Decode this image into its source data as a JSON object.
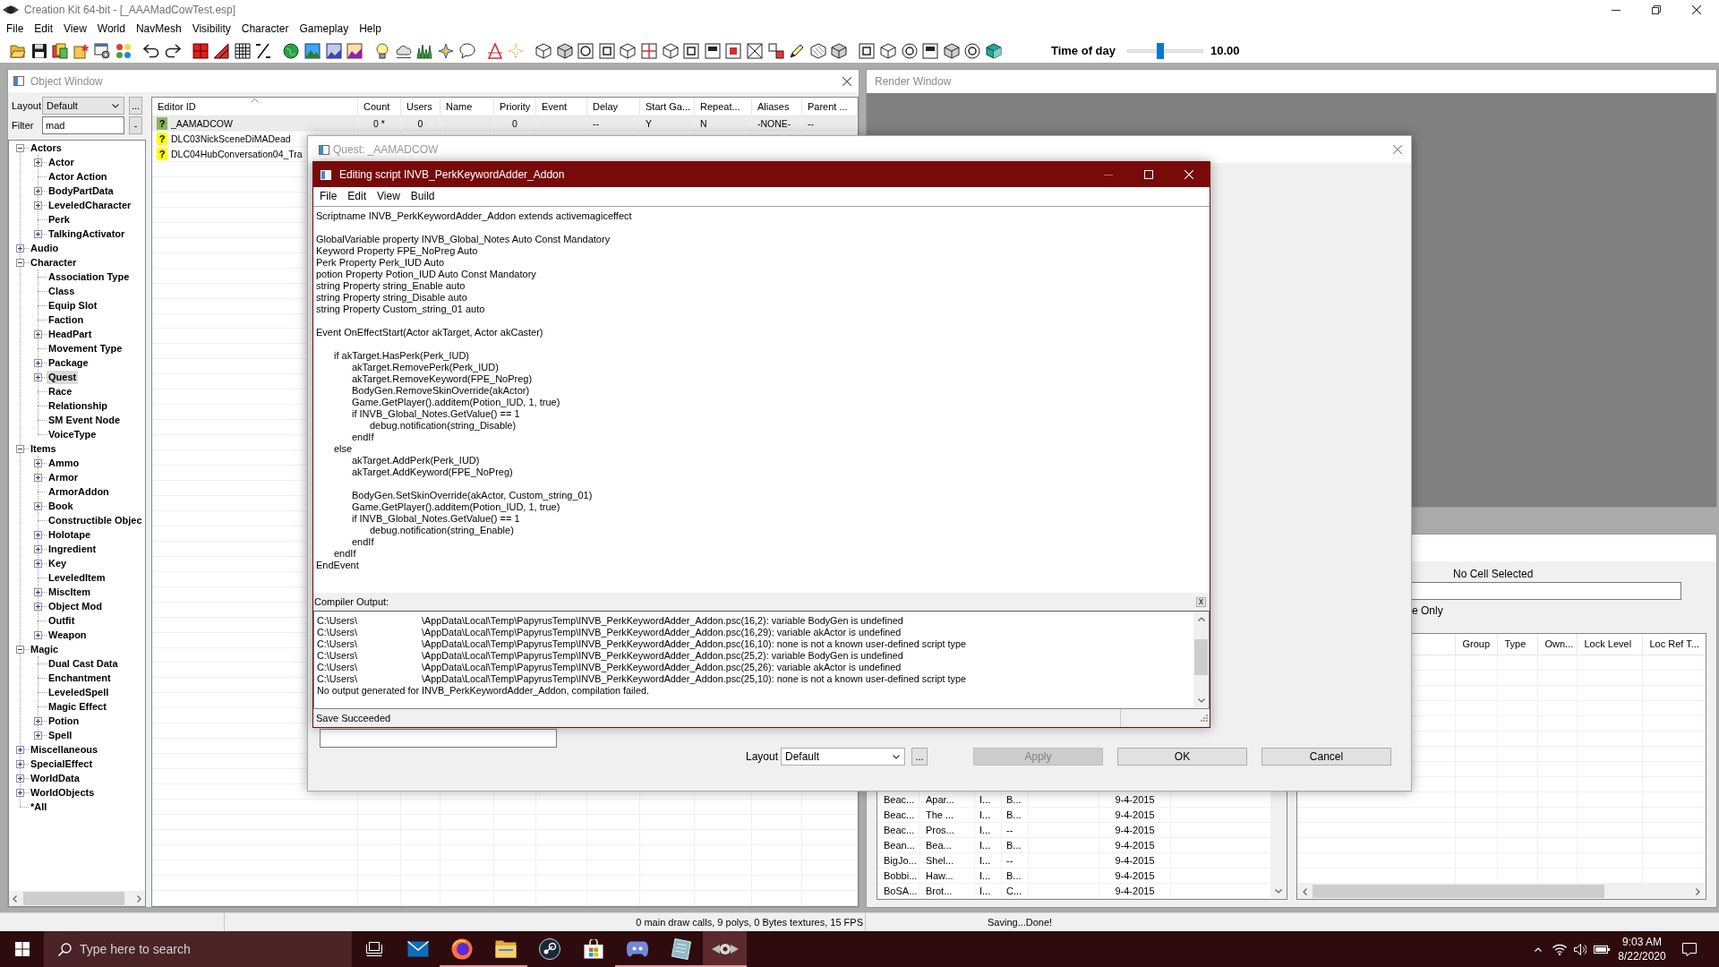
{
  "window": {
    "title": "Creation Kit 64-bit - [_AAAMadCowTest.esp]"
  },
  "menu": [
    "File",
    "Edit",
    "View",
    "World",
    "NavMesh",
    "Visibility",
    "Character",
    "Gameplay",
    "Help"
  ],
  "toolbar": {
    "time_of_day": {
      "label": "Time of day",
      "level": 0.42,
      "reading": "10.00"
    }
  },
  "object_window": {
    "title": "Object Window",
    "layout": {
      "label": "Layout",
      "value": "Default",
      "button": "..."
    },
    "filter": {
      "label": "Filter",
      "value": "mad",
      "button": "-"
    },
    "tree": [
      {
        "label": "Actors",
        "expanded": true,
        "selected": false,
        "children": [
          {
            "label": "Actor",
            "expanded": false,
            "selected": false
          },
          {
            "label": "Actor Action",
            "selected": false
          },
          {
            "label": "BodyPartData",
            "expanded": false,
            "selected": false
          },
          {
            "label": "LeveledCharacter",
            "expanded": false,
            "selected": false
          },
          {
            "label": "Perk",
            "selected": false
          },
          {
            "label": "TalkingActivator",
            "expanded": false,
            "selected": false
          }
        ]
      },
      {
        "label": "Audio",
        "expanded": false,
        "selected": false
      },
      {
        "label": "Character",
        "expanded": true,
        "selected": false,
        "children": [
          {
            "label": "Association Type",
            "selected": false
          },
          {
            "label": "Class",
            "selected": false
          },
          {
            "label": "Equip Slot",
            "selected": false
          },
          {
            "label": "Faction",
            "selected": false
          },
          {
            "label": "HeadPart",
            "expanded": false,
            "selected": false
          },
          {
            "label": "Movement Type",
            "selected": false
          },
          {
            "label": "Package",
            "expanded": false,
            "selected": false
          },
          {
            "label": "Quest",
            "expanded": false,
            "selected": true
          },
          {
            "label": "Race",
            "selected": false
          },
          {
            "label": "Relationship",
            "selected": false
          },
          {
            "label": "SM Event Node",
            "selected": false
          },
          {
            "label": "VoiceType",
            "selected": false
          }
        ]
      },
      {
        "label": "Items",
        "expanded": true,
        "selected": false,
        "children": [
          {
            "label": "Ammo",
            "expanded": false,
            "selected": false
          },
          {
            "label": "Armor",
            "expanded": false,
            "selected": false
          },
          {
            "label": "ArmorAddon",
            "selected": false
          },
          {
            "label": "Book",
            "expanded": false,
            "selected": false
          },
          {
            "label": "Constructible Objec",
            "selected": false
          },
          {
            "label": "Holotape",
            "expanded": false,
            "selected": false
          },
          {
            "label": "Ingredient",
            "expanded": false,
            "selected": false
          },
          {
            "label": "Key",
            "expanded": false,
            "selected": false
          },
          {
            "label": "LeveledItem",
            "selected": false
          },
          {
            "label": "MiscItem",
            "expanded": false,
            "selected": false
          },
          {
            "label": "Object Mod",
            "expanded": false,
            "selected": false
          },
          {
            "label": "Outfit",
            "selected": false
          },
          {
            "label": "Weapon",
            "expanded": false,
            "selected": false
          }
        ]
      },
      {
        "label": "Magic",
        "expanded": true,
        "selected": false,
        "children": [
          {
            "label": "Dual Cast Data",
            "selected": false
          },
          {
            "label": "Enchantment",
            "selected": false
          },
          {
            "label": "LeveledSpell",
            "selected": false
          },
          {
            "label": "Magic Effect",
            "selected": false
          },
          {
            "label": "Potion",
            "expanded": false,
            "selected": false
          },
          {
            "label": "Spell",
            "expanded": false,
            "selected": false
          }
        ]
      },
      {
        "label": "Miscellaneous",
        "expanded": false,
        "selected": false
      },
      {
        "label": "SpecialEffect",
        "expanded": false,
        "selected": false
      },
      {
        "label": "WorldData",
        "expanded": false,
        "selected": false
      },
      {
        "label": "WorldObjects",
        "expanded": false,
        "selected": false
      },
      {
        "label": "*All",
        "selected": false
      }
    ],
    "table": {
      "columns": [
        "Editor ID",
        "Count",
        "Users",
        "Name",
        "Priority",
        "Event",
        "Delay",
        "Start Ga...",
        "Repeat...",
        "Aliases",
        "Parent ..."
      ],
      "rows": [
        {
          "mark": "?",
          "color": "#8bb35a",
          "selected": true,
          "cells": [
            "_AAMADCOW",
            "0 *",
            "0",
            null,
            "0",
            null,
            "--",
            "Y",
            "N",
            "-NONE-",
            "--"
          ]
        },
        {
          "mark": "?",
          "color": "#ffff00",
          "selected": false,
          "cells": [
            "DLC03NickSceneDiMADead"
          ]
        },
        {
          "mark": "?",
          "color": "#ffff00",
          "selected": false,
          "cells": [
            "DLC04HubConversation04_Tra"
          ]
        }
      ]
    }
  },
  "render_window": {
    "title": "Render Window"
  },
  "cell_view": {
    "heading": "No Cell Selected",
    "option": "e Only",
    "cell_list": {
      "rows": [
        [
          "Beac...",
          "Apar...",
          "I...",
          "B...",
          null,
          "9-4-2015"
        ],
        [
          "Beac...",
          "The ...",
          "I...",
          "B...",
          null,
          "9-4-2015"
        ],
        [
          "Beac...",
          "Pros...",
          "I...",
          "--",
          null,
          "9-4-2015"
        ],
        [
          "Bean...",
          "Bea...",
          "I...",
          "B...",
          null,
          "9-4-2015"
        ],
        [
          "BigJo...",
          "Shel...",
          "I...",
          "--",
          null,
          "9-4-2015"
        ],
        [
          "Bobbi...",
          "Haw...",
          "I...",
          "B...",
          null,
          "9-4-2015"
        ],
        [
          "BoSA...",
          "Brot...",
          "I...",
          "C...",
          null,
          "9-4-2015"
        ]
      ]
    },
    "object_list": {
      "columns": [
        "Group",
        "Type",
        "Own...",
        "Lock Level",
        "Loc Ref T..."
      ]
    }
  },
  "quest_dialog": {
    "title": "Quest: _AAMADCOW",
    "layout": {
      "label": "Layout",
      "value": "Default",
      "button": "..."
    },
    "buttons": [
      {
        "label": "Apply",
        "disabled": true
      },
      {
        "label": "OK",
        "disabled": false
      },
      {
        "label": "Cancel",
        "disabled": false
      }
    ]
  },
  "script_editor": {
    "title": "Editing script INVB_PerkKeywordAdder_Addon",
    "caption_buttons": [
      {
        "kind": "minimize",
        "disabled": true
      },
      {
        "kind": "maximize",
        "disabled": false
      },
      {
        "kind": "close",
        "disabled": false
      }
    ],
    "menu": [
      "File",
      "Edit",
      "View",
      "Build"
    ],
    "code": [
      [
        "Scriptname INVB_PerkKeywordAdder_Addon extends activemagiceffect"
      ],
      [
        "GlobalVariable property INVB_Global_Notes Auto Const Mandatory",
        "Keyword Property FPE_NoPreg Auto",
        "Perk Property Perk_IUD Auto",
        "potion Property Potion_IUD Auto Const Mandatory",
        "string Property string_Enable auto",
        "string Property string_Disable auto",
        "string Property Custom_string_01 auto"
      ],
      [
        "Event OnEffectStart(Actor akTarget, Actor akCaster)"
      ],
      [
        "\tif akTarget.HasPerk(Perk_IUD)",
        "\t\takTarget.RemovePerk(Perk_IUD)",
        "\t\takTarget.RemoveKeyword(FPE_NoPreg)",
        "\t\tBodyGen.RemoveSkinOverride(akActor)",
        "\t\tGame.GetPlayer().additem(Potion_IUD, 1, true)",
        "\t\tif INVB_Global_Notes.GetValue() == 1",
        "\t\t\tdebug.notification(string_Disable)",
        "\t\tendIf",
        "\telse",
        "\t\takTarget.AddPerk(Perk_IUD)",
        "\t\takTarget.AddKeyword(FPE_NoPreg)"
      ],
      [
        "\t\tBodyGen.SetSkinOverride(akActor, Custom_string_01)",
        "\t\tGame.GetPlayer().additem(Potion_IUD, 1, true)",
        "\t\tif INVB_Global_Notes.GetValue() == 1",
        "\t\t\tdebug.notification(string_Enable)",
        "\t\tendIf",
        "\tendIf",
        "EndEvent"
      ]
    ],
    "compiler_output": {
      "label": "Compiler Output:",
      "close": "x",
      "lines": [
        {
          "path": "C:\\Users\\",
          "message": "\\AppData\\Local\\Temp\\PapyrusTemp\\INVB_PerkKeywordAdder_Addon.psc(16,2): variable BodyGen is undefined"
        },
        {
          "path": "C:\\Users\\",
          "message": "\\AppData\\Local\\Temp\\PapyrusTemp\\INVB_PerkKeywordAdder_Addon.psc(16,29): variable akActor is undefined"
        },
        {
          "path": "C:\\Users\\",
          "message": "\\AppData\\Local\\Temp\\PapyrusTemp\\INVB_PerkKeywordAdder_Addon.psc(16,10): none is not a known user-defined script type"
        },
        {
          "path": "C:\\Users\\",
          "message": "\\AppData\\Local\\Temp\\PapyrusTemp\\INVB_PerkKeywordAdder_Addon.psc(25,2): variable BodyGen is undefined"
        },
        {
          "path": "C:\\Users\\",
          "message": "\\AppData\\Local\\Temp\\PapyrusTemp\\INVB_PerkKeywordAdder_Addon.psc(25,26): variable akActor is undefined"
        },
        {
          "path": "C:\\Users\\",
          "message": "\\AppData\\Local\\Temp\\PapyrusTemp\\INVB_PerkKeywordAdder_Addon.psc(25,10): none is not a known user-defined script type"
        },
        {
          "message": "No output generated for INVB_PerkKeywordAdder_Addon, compilation failed."
        }
      ]
    },
    "status": "Save Succeeded"
  },
  "status_bar": [
    "0 main draw calls, 9 polys, 0 Bytes textures, 15 FPS",
    "Saving...Done!"
  ],
  "taskbar": {
    "search": {
      "placeholder": "Type here to search"
    },
    "apps": [
      {
        "running": false,
        "selected": false
      },
      {
        "running": true,
        "selected": false
      },
      {
        "running": true,
        "selected": false
      },
      {
        "running": false,
        "selected": false
      },
      {
        "running": false,
        "selected": false
      },
      {
        "running": true,
        "selected": false
      },
      {
        "running": true,
        "selected": false
      },
      {
        "running": true,
        "selected": true
      }
    ],
    "clock": {
      "time": "9:03 AM",
      "date": "8/22/2020"
    }
  }
}
